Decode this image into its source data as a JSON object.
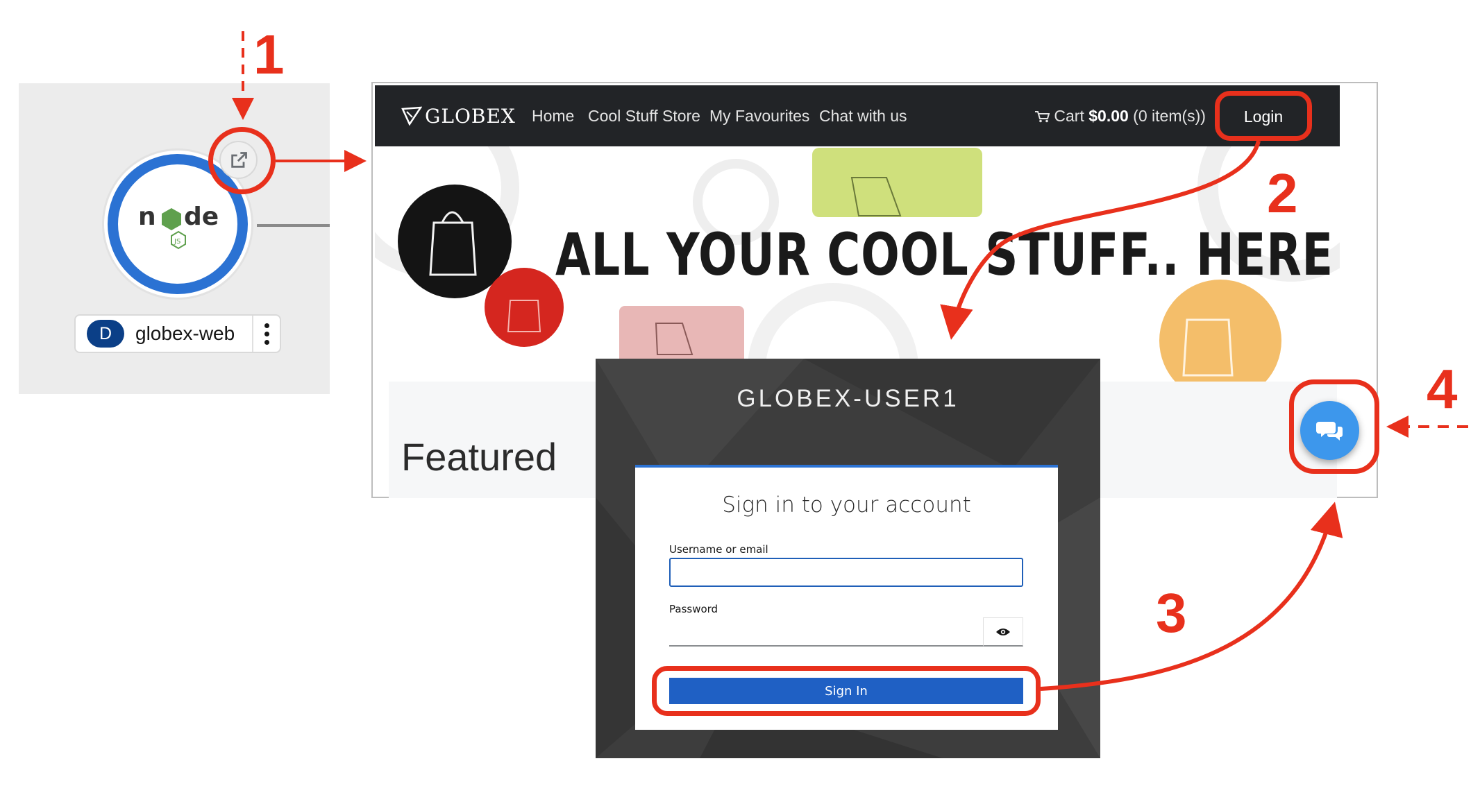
{
  "topology": {
    "app_badge": "D",
    "app_name": "globex-web",
    "runtime_logo": "nodejs-logo",
    "open_url_icon": "external-link-icon"
  },
  "store": {
    "brand": "GLOBEX",
    "nav": [
      "Home",
      "Cool Stuff Store",
      "My Favourites",
      "Chat with us"
    ],
    "cart_prefix": "Cart ",
    "cart_amount": "$0.00",
    "cart_items": " (0 item(s))",
    "login": "Login",
    "hero_title": "ALL YOUR COOL STUFF.. HERE",
    "featured": "Featured",
    "chat_icon": "chat-bubbles-icon"
  },
  "login_dialog": {
    "realm": "GLOBEX-USER1",
    "heading": "Sign in to your account",
    "username_label": "Username or email",
    "username_value": "",
    "password_label": "Password",
    "password_value": "",
    "sign_in": "Sign In"
  },
  "annotations": {
    "accent": "#e8301c",
    "steps": [
      "1",
      "2",
      "3",
      "4"
    ]
  }
}
